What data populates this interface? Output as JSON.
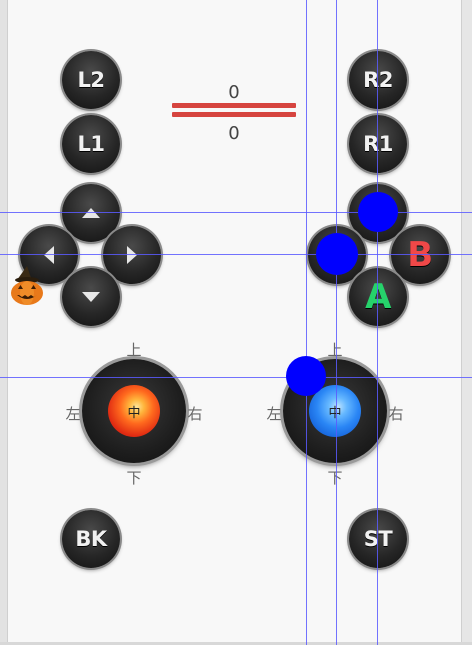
{
  "triggers": {
    "left_value": "0",
    "right_value": "0"
  },
  "shoulder": {
    "l2": "L2",
    "l1": "L1",
    "r2": "R2",
    "r1": "R1"
  },
  "dpad": {
    "up_icon": "arrow-up-icon",
    "down_icon": "arrow-down-icon",
    "left_icon": "arrow-left-icon",
    "right_icon": "arrow-right-icon"
  },
  "face_buttons": {
    "b": "B",
    "a": "A",
    "colors": {
      "b": "#f04848",
      "a": "#26d26b"
    }
  },
  "sticks": {
    "left": {
      "up": "上",
      "down": "下",
      "left": "左",
      "right": "右",
      "center": "中"
    },
    "right": {
      "up": "上",
      "down": "下",
      "left": "左",
      "right": "右",
      "center": "中"
    }
  },
  "system": {
    "back": "BK",
    "start": "ST"
  },
  "touch_dot_color": "#0000ff",
  "decor": {
    "mascot_icon": "pumpkin-icon"
  }
}
